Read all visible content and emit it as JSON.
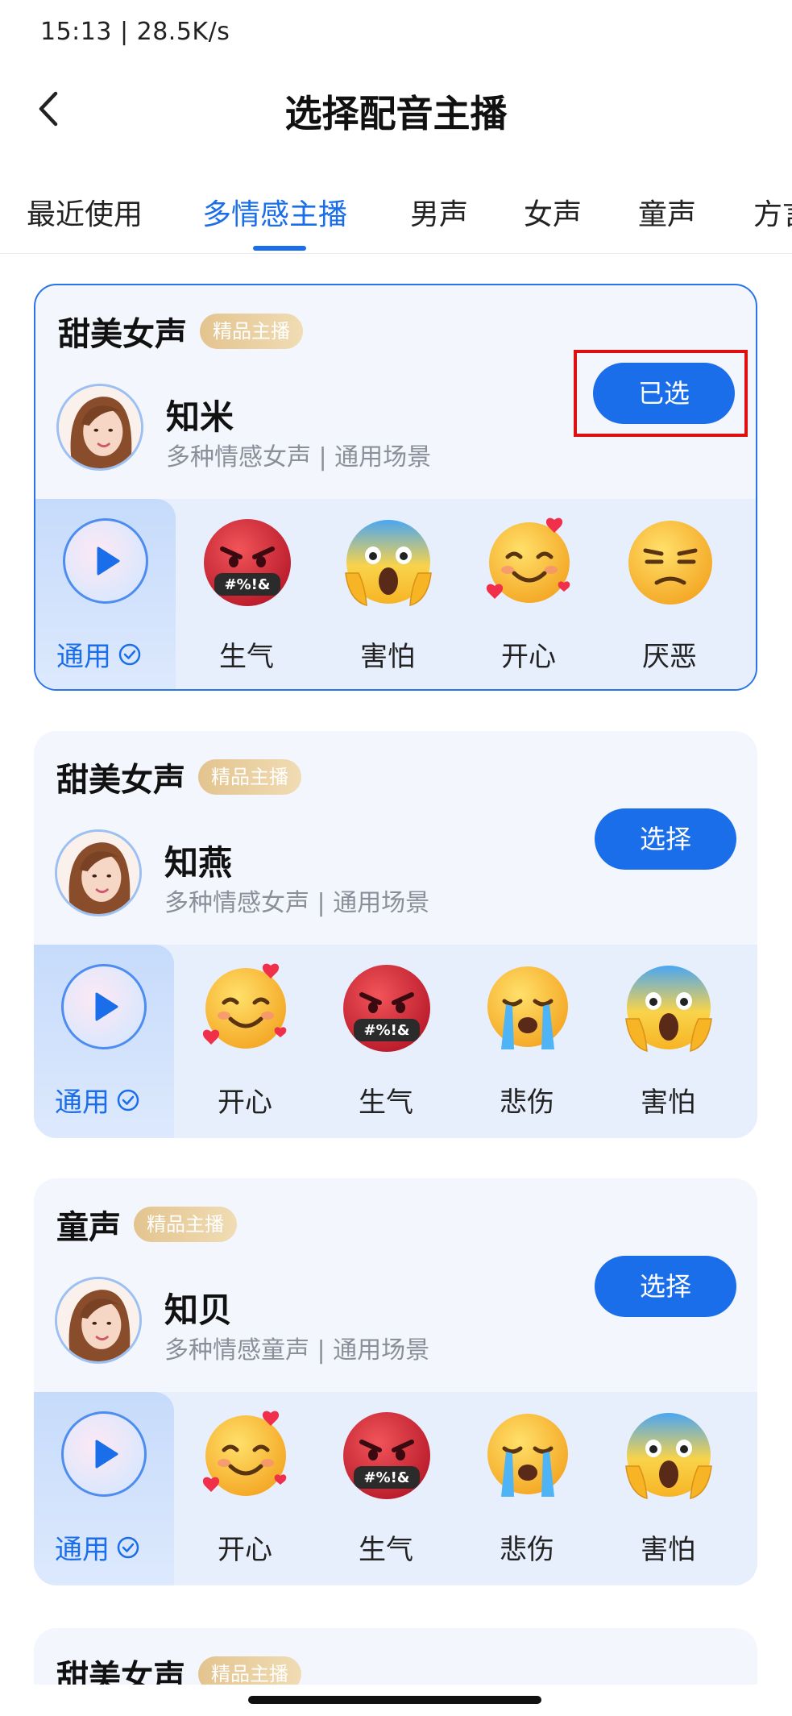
{
  "status_bar": {
    "text": "15:13 | 28.5K/s"
  },
  "nav": {
    "title": "选择配音主播"
  },
  "tabs": [
    {
      "label": "最近使用"
    },
    {
      "label": "多情感主播"
    },
    {
      "label": "男声"
    },
    {
      "label": "女声"
    },
    {
      "label": "童声"
    },
    {
      "label": "方言"
    }
  ],
  "cards": [
    {
      "category": "甜美女声",
      "badge": "精品主播",
      "name": "知米",
      "desc": "多种情感女声 | 通用场景",
      "button": "已选",
      "general_label": "通用",
      "emotions": [
        {
          "label": "生气",
          "icon": "angry-emoji-icon"
        },
        {
          "label": "害怕",
          "icon": "scared-emoji-icon"
        },
        {
          "label": "开心",
          "icon": "happy-emoji-icon"
        },
        {
          "label": "厌恶",
          "icon": "disgust-emoji-icon"
        }
      ]
    },
    {
      "category": "甜美女声",
      "badge": "精品主播",
      "name": "知燕",
      "desc": "多种情感女声 | 通用场景",
      "button": "选择",
      "general_label": "通用",
      "emotions": [
        {
          "label": "开心",
          "icon": "happy-emoji-icon"
        },
        {
          "label": "生气",
          "icon": "angry-emoji-icon"
        },
        {
          "label": "悲伤",
          "icon": "sad-emoji-icon"
        },
        {
          "label": "害怕",
          "icon": "scared-emoji-icon"
        }
      ]
    },
    {
      "category": "童声",
      "badge": "精品主播",
      "name": "知贝",
      "desc": "多种情感童声 | 通用场景",
      "button": "选择",
      "general_label": "通用",
      "emotions": [
        {
          "label": "开心",
          "icon": "happy-emoji-icon"
        },
        {
          "label": "生气",
          "icon": "angry-emoji-icon"
        },
        {
          "label": "悲伤",
          "icon": "sad-emoji-icon"
        },
        {
          "label": "害怕",
          "icon": "scared-emoji-icon"
        }
      ]
    },
    {
      "category": "甜美女声",
      "badge": "精品主播"
    }
  ],
  "emoji_text": {
    "angry": "#%!&"
  },
  "colors": {
    "accent": "#1a6eea",
    "highlight": "#e01010",
    "badge": "#e3c48f"
  }
}
